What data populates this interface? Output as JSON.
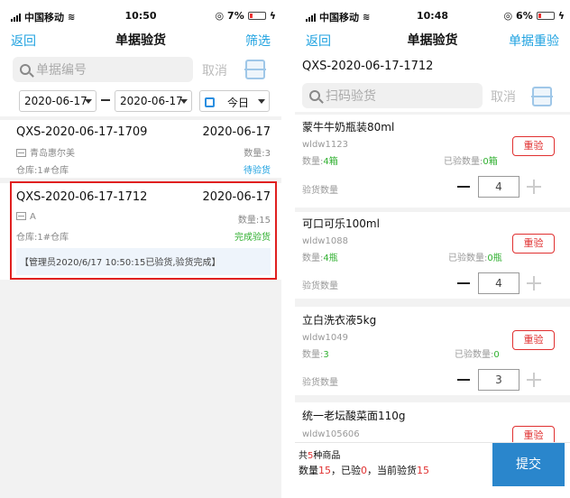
{
  "left": {
    "status": {
      "carrier": "中国移动",
      "time": "10:50",
      "battery": "7%"
    },
    "nav": {
      "back": "返回",
      "title": "单据验货",
      "action": "筛选"
    },
    "search": {
      "placeholder": "单据编号",
      "cancel": "取消"
    },
    "filter": {
      "date_from": "2020-06-17",
      "date_to": "2020-06-17",
      "range": "今日"
    },
    "orders": [
      {
        "no": "QXS-2020-06-17-1709",
        "date": "2020-06-17",
        "customer": "青岛惠尔美",
        "qty": "数量:3",
        "warehouse": "仓库:1#仓库",
        "status": "待验货"
      },
      {
        "no": "QXS-2020-06-17-1712",
        "date": "2020-06-17",
        "customer": "A",
        "qty": "数量:15",
        "warehouse": "仓库:1#仓库",
        "status": "完成验货",
        "log": "【管理员2020/6/17 10:50:15已验货,验货完成】"
      }
    ]
  },
  "right": {
    "status": {
      "carrier": "中国移动",
      "time": "10:48",
      "battery": "6%"
    },
    "nav": {
      "back": "返回",
      "title": "单据验货",
      "action": "单据重验"
    },
    "order_no": "QXS-2020-06-17-1712",
    "search": {
      "placeholder": "扫码验货",
      "cancel": "取消"
    },
    "products": [
      {
        "name": "蒙牛牛奶瓶装80ml",
        "code": "wldw1123",
        "qty_label": "数量:",
        "qty": "4箱",
        "checked_label": "已验数量:",
        "checked": "0箱",
        "recheck": "重验",
        "input_label": "验货数量",
        "input": "4"
      },
      {
        "name": "可口可乐100ml",
        "code": "wldw1088",
        "qty_label": "数量:",
        "qty": "4瓶",
        "checked_label": "已验数量:",
        "checked": "0瓶",
        "recheck": "重验",
        "input_label": "验货数量",
        "input": "4"
      },
      {
        "name": "立白洗衣液5kg",
        "code": "wldw1049",
        "qty_label": "数量:",
        "qty": "3",
        "checked_label": "已验数量:",
        "checked": "0",
        "recheck": "重验",
        "input_label": "验货数量",
        "input": "3"
      },
      {
        "name": "统一老坛酸菜面110g",
        "code": "wldw105606",
        "recheck": "重验"
      }
    ],
    "footer": {
      "line1_pre": "共",
      "kinds": "5",
      "line1_post": "种商品",
      "qty_label": "数量",
      "qty": "15",
      "checked_label": "，已验",
      "checked": "0",
      "current_label": "，当前验货",
      "current": "15",
      "submit": "提交"
    }
  }
}
